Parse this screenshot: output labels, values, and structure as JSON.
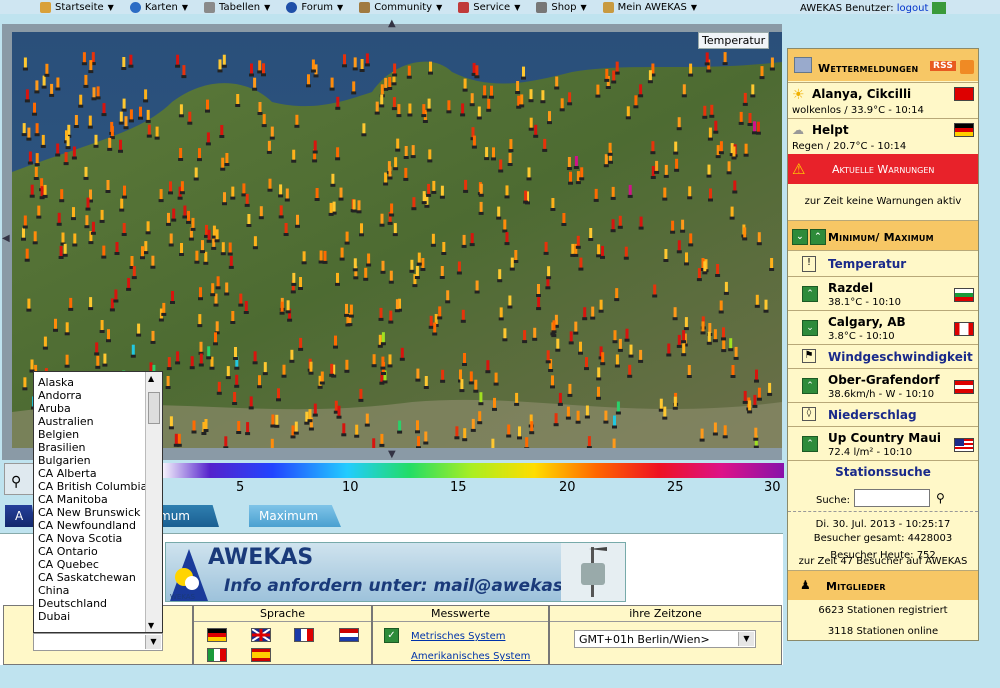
{
  "nav": {
    "items": [
      "Startseite",
      "Karten",
      "Tabellen",
      "Forum",
      "Community",
      "Service",
      "Shop",
      "Mein AWEKAS"
    ],
    "user_text": "AWEKAS Benutzer:",
    "logout": "logout"
  },
  "map": {
    "label": "Temperatur"
  },
  "legend": {
    "ticks": [
      "5",
      "10",
      "15",
      "20",
      "25",
      "30"
    ]
  },
  "tabs": {
    "a": "A",
    "minimum": "mum",
    "maximum": "Maximum"
  },
  "banner": {
    "title": "AWEKAS",
    "info_prefix": "Info anfordern unter:",
    "mail": "mail@awekas.at",
    "logo_caption": "WEKAS"
  },
  "bottom": {
    "sprache": "Sprache",
    "messwerte": "Messwerte",
    "metrisch": "Metrisches System",
    "amerikanisch": "Amerikanisches System",
    "zeitzone": "ihre Zeitzone",
    "tz_value": "GMT+01h Berlin/Wien>"
  },
  "countries": [
    "Alaska",
    "Andorra",
    "Aruba",
    "Australien",
    "Belgien",
    "Brasilien",
    "Bulgarien",
    "CA Alberta",
    "CA British Columbia",
    "CA Manitoba",
    "CA New Brunswick",
    "CA Newfoundland",
    "CA Nova Scotia",
    "CA Ontario",
    "CA Quebec",
    "CA Saskatchewan",
    "China",
    "Deutschland",
    "Dubai"
  ],
  "sidebar": {
    "wetter_head": "Wettermeldungen",
    "rss": "RSS",
    "report1_place": "Alanya, Cikcilli",
    "report1_detail": "wolkenlos / 33.9°C - 10:14",
    "report2_place": "Helpt",
    "report2_detail": "Regen / 20.7°C - 10:14",
    "warn_head": "Aktuelle Warnungen",
    "warn_text": "zur Zeit keine Warnungen aktiv",
    "minmax_head": "Minimum/ Maximum",
    "temp_label": "Temperatur",
    "temp1_place": "Razdel",
    "temp1_detail": "38.1°C - 10:10",
    "temp2_place": "Calgary, AB",
    "temp2_detail": "3.8°C - 10:10",
    "wind_label": "Windgeschwindigkeit",
    "wind_place": "Ober-Grafendorf",
    "wind_detail": "38.6km/h - W - 10:10",
    "rain_label": "Niederschlag",
    "rain_place": "Up Country Maui",
    "rain_detail": "72.4 l/m² - 10:10",
    "search_head": "Stationssuche",
    "search_label": "Suche:",
    "date_line": "Di. 30. Jul. 2013 - 10:25:17",
    "total_visitors": "Besucher gesamt: 4428003",
    "today_visitors": "Besucher Heute: 752",
    "current_visitors": "zur Zeit 47 Besucher auf AWEKAS",
    "members_head": "Mitglieder",
    "stations_registered": "6623 Stationen registriert",
    "stations_online": "3118 Stationen online"
  }
}
